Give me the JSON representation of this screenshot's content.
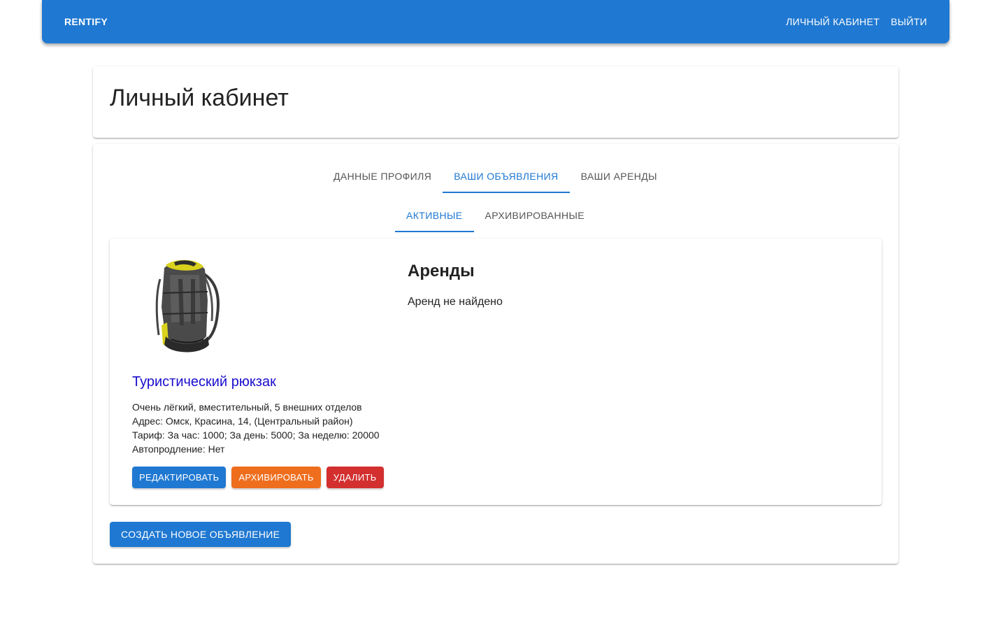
{
  "header": {
    "brand": "RENTIFY",
    "nav": {
      "cabinet": "ЛИЧНЫЙ КАБИНЕТ",
      "logout": "ВЫЙТИ"
    }
  },
  "page": {
    "title": "Личный кабинет"
  },
  "tabs": {
    "main": [
      {
        "label": "ДАННЫЕ ПРОФИЛЯ",
        "active": false
      },
      {
        "label": "ВАШИ ОБЪЯВЛЕНИЯ",
        "active": true
      },
      {
        "label": "ВАШИ АРЕНДЫ",
        "active": false
      }
    ],
    "sub": [
      {
        "label": "АКТИВНЫЕ",
        "active": true
      },
      {
        "label": "АРХИВИРОВАННЫЕ",
        "active": false
      }
    ]
  },
  "listing": {
    "image_icon": "backpack-image",
    "title": "Туристический рюкзак",
    "description": "Очень лёгкий, вместительный, 5 внешних отделов",
    "address": "Адрес: Омск, Красина, 14, (Центральный район)",
    "tariff": "Тариф: За час: 1000; За день: 5000; За неделю: 20000",
    "autorenew": "Автопродление: Нет",
    "actions": {
      "edit": "РЕДАКТИРОВАТЬ",
      "archive": "АРХИВИРОВАТЬ",
      "delete": "УДАЛИТЬ"
    },
    "rentals": {
      "title": "Аренды",
      "empty": "Аренд не найдено"
    }
  },
  "create_button": "СОЗДАТЬ НОВОЕ ОБЪЯВЛЕНИЕ",
  "colors": {
    "primary": "#1f78d1",
    "archive": "#ee6e1e",
    "delete": "#d32f2f",
    "link": "#1a0dcc"
  }
}
